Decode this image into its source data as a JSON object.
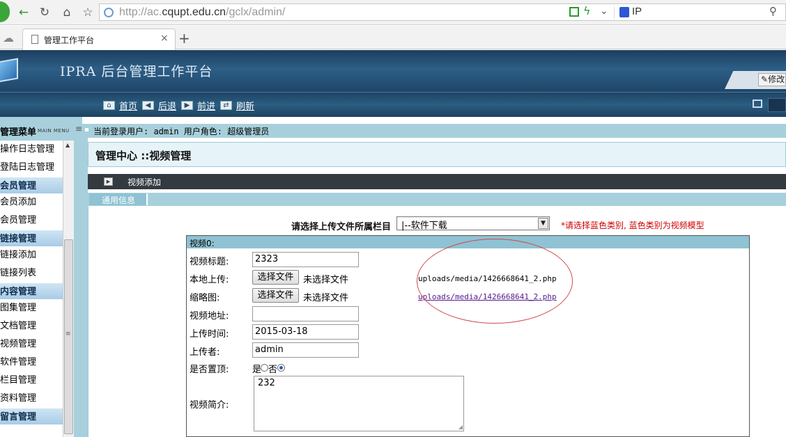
{
  "browser": {
    "url_prefix": "http://ac.",
    "url_domain": "cqupt.edu.cn",
    "url_path": "/gclx/admin/",
    "search_term": "IP",
    "tab_title": "管理工作平台",
    "new_tab": "+"
  },
  "header": {
    "title": "IPRA  后台管理工作平台",
    "modify_label": "修改"
  },
  "toolbar": {
    "items": [
      {
        "label": "首页",
        "icon": "home-icon"
      },
      {
        "label": "后退",
        "icon": "arrow-left-icon"
      },
      {
        "label": "前进",
        "icon": "arrow-right-icon"
      },
      {
        "label": "刷新",
        "icon": "refresh-icon"
      }
    ]
  },
  "sidebar": {
    "heading": "管理菜单",
    "heading_en": "MAIN MENU",
    "items": [
      {
        "label": "操作日志管理",
        "type": "sub"
      },
      {
        "label": "登陆日志管理",
        "type": "sub"
      },
      {
        "label": "会员管理",
        "type": "cat"
      },
      {
        "label": "会员添加",
        "type": "sub"
      },
      {
        "label": "会员管理",
        "type": "sub"
      },
      {
        "label": "链接管理",
        "type": "cat"
      },
      {
        "label": "链接添加",
        "type": "sub"
      },
      {
        "label": "链接列表",
        "type": "sub"
      },
      {
        "label": "内容管理",
        "type": "cat"
      },
      {
        "label": "图集管理",
        "type": "sub"
      },
      {
        "label": "文档管理",
        "type": "sub"
      },
      {
        "label": "视频管理",
        "type": "sub"
      },
      {
        "label": "软件管理",
        "type": "sub"
      },
      {
        "label": "栏目管理",
        "type": "sub"
      },
      {
        "label": "资料管理",
        "type": "sub"
      },
      {
        "label": "留言管理",
        "type": "cat"
      }
    ]
  },
  "status": {
    "text": "当前登录用户: admin  用户角色: 超级管理员"
  },
  "main": {
    "title": "管理中心 ::视频管理",
    "subbar_label": "视频添加",
    "section_label": "通用信息",
    "category_label": "请选择上传文件所属栏目",
    "category_value": "|--软件下载",
    "category_hint": "*请选择蓝色类别, 蓝色类别为视频模型"
  },
  "video": {
    "heading": "视频0:",
    "title_label": "视频标题:",
    "title_value": "2323",
    "local_upload_label": "本地上传:",
    "thumbnail_label": "缩略图:",
    "choose_file": "选择文件",
    "no_file": "未选择文件",
    "upload_path": "uploads/media/1426668641_2.php",
    "thumbnail_path": "uploads/media/1426668641_2.php",
    "url_label": "视频地址:",
    "url_value": "",
    "time_label": "上传时间:",
    "time_value": "2015-03-18",
    "uploader_label": "上传者:",
    "uploader_value": "admin",
    "pin_label": "是否置顶:",
    "pin_yes": "是",
    "pin_no": "否",
    "pin_selected": "否",
    "desc_label": "视频简介:",
    "desc_value": "232"
  },
  "colors": {
    "header_blue": "#2d5e86",
    "sidebar_teal": "#a8d0dc",
    "hint_red": "#d00000",
    "annotation_red": "#d04a4a"
  }
}
